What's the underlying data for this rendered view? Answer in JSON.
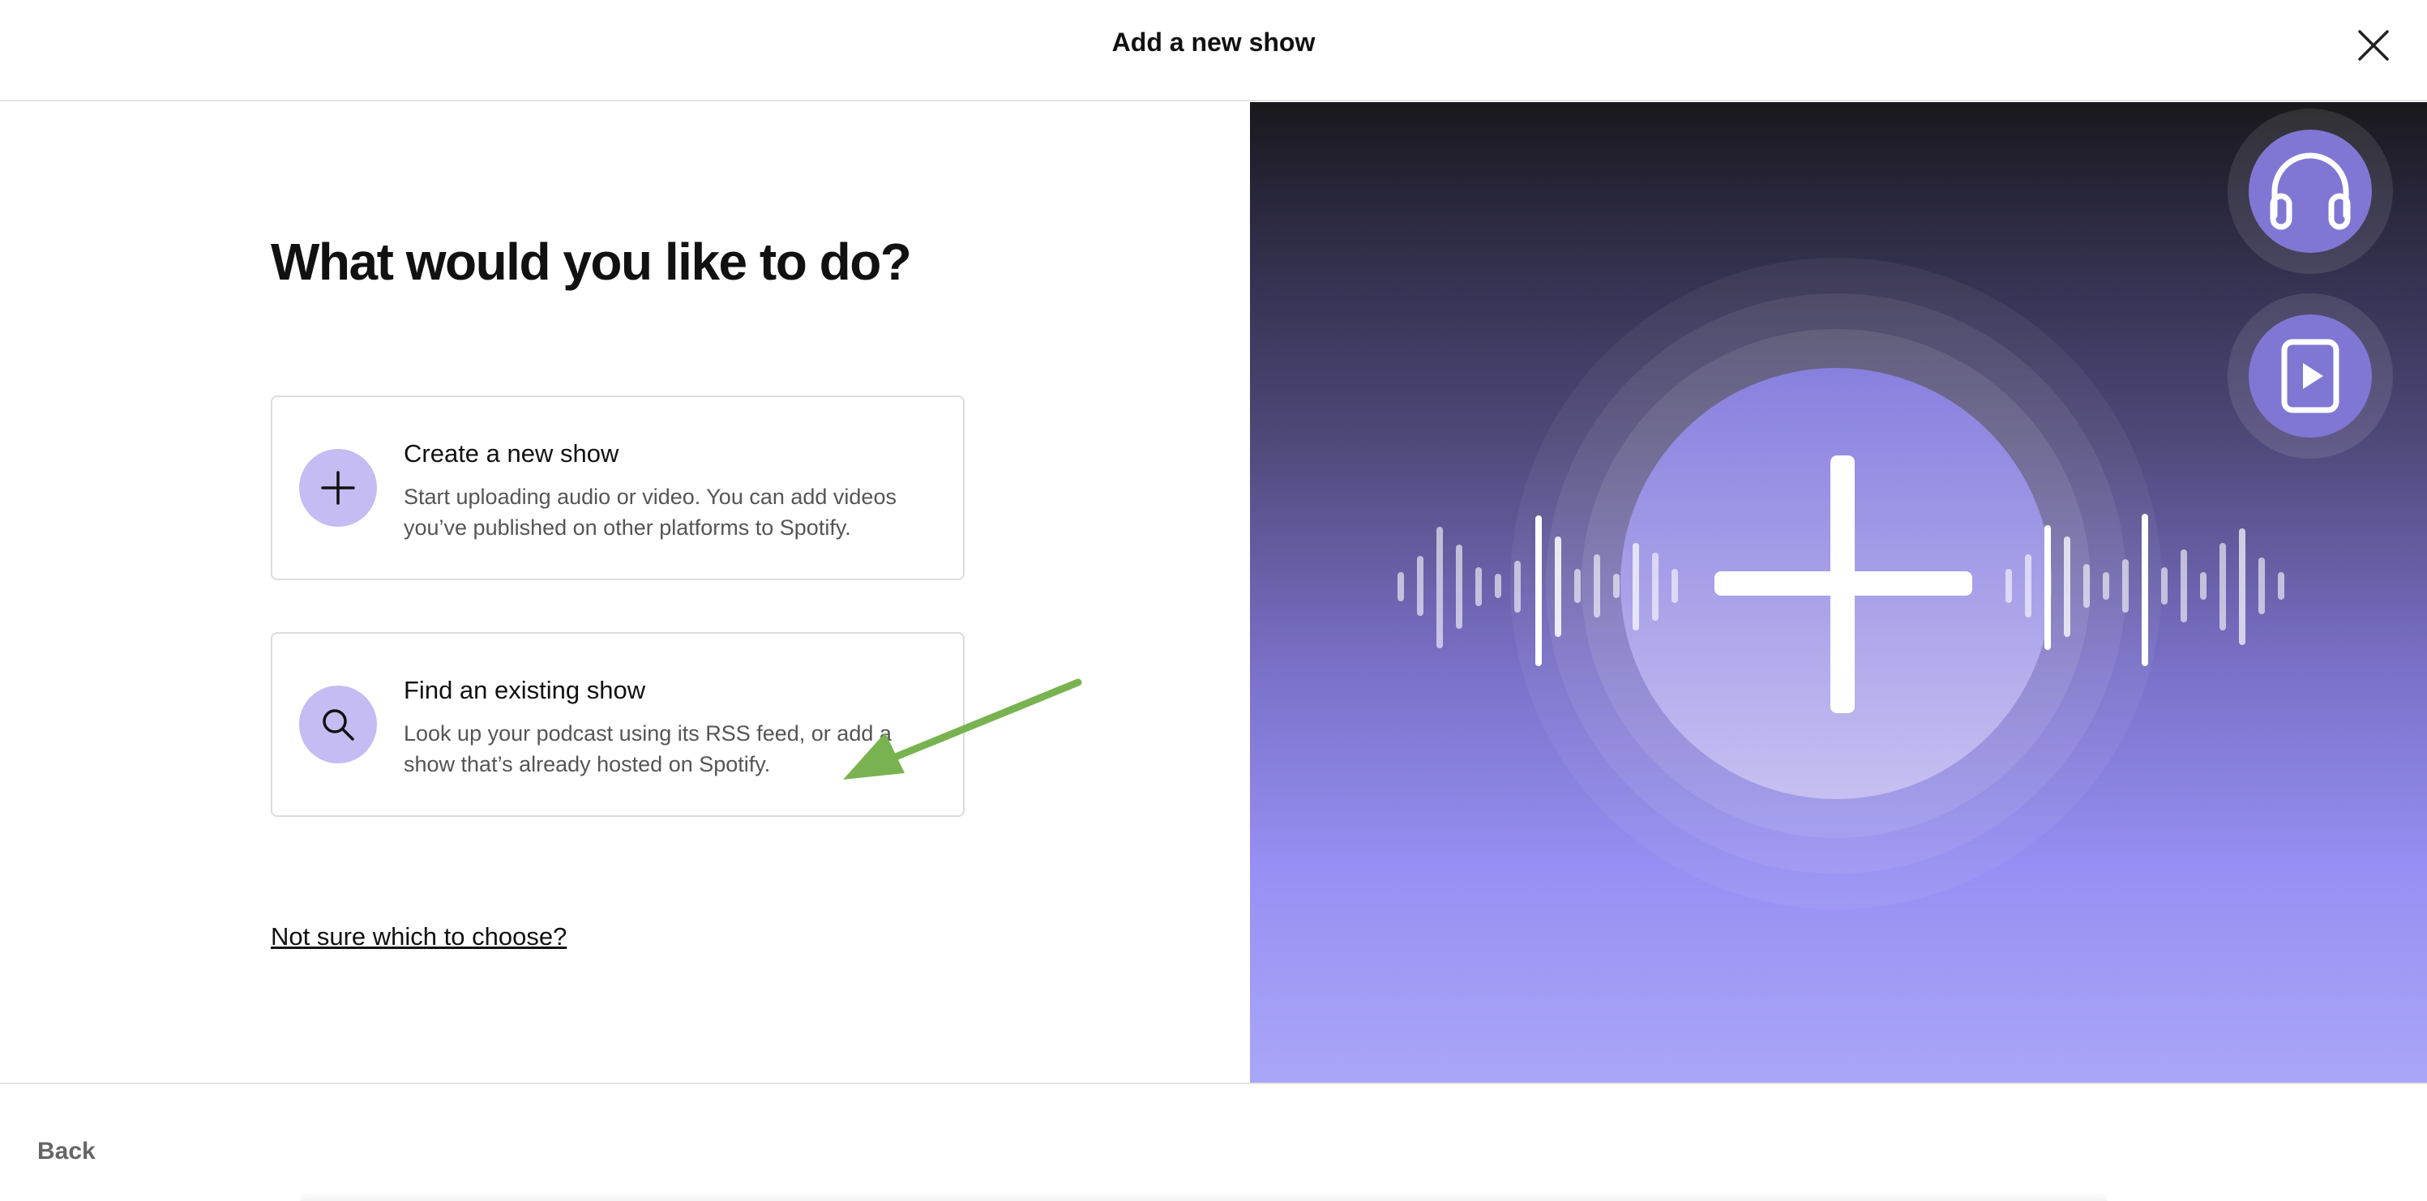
{
  "header": {
    "title": "Add a new show",
    "close_icon": "close-icon"
  },
  "main": {
    "heading": "What would you like to do?",
    "options": [
      {
        "title": "Create a new show",
        "description": "Start uploading audio or video. You can add videos you’ve published on other platforms to Spotify.",
        "icon": "plus-icon"
      },
      {
        "title": "Find an existing show",
        "description": "Look up your podcast using its RSS feed, or add a show that’s already hosted on Spotify.",
        "icon": "search-icon"
      }
    ],
    "help_link": "Not sure which to choose?"
  },
  "illustration": {
    "icons": [
      "headphones-icon",
      "video-play-icon",
      "plus-icon"
    ]
  },
  "footer": {
    "back_label": "Back"
  },
  "colors": {
    "accent_light_purple": "#c4bcf2",
    "arrow_green": "#79b351",
    "gradient_top": "#19181c",
    "gradient_bottom": "#aaa6f7"
  }
}
